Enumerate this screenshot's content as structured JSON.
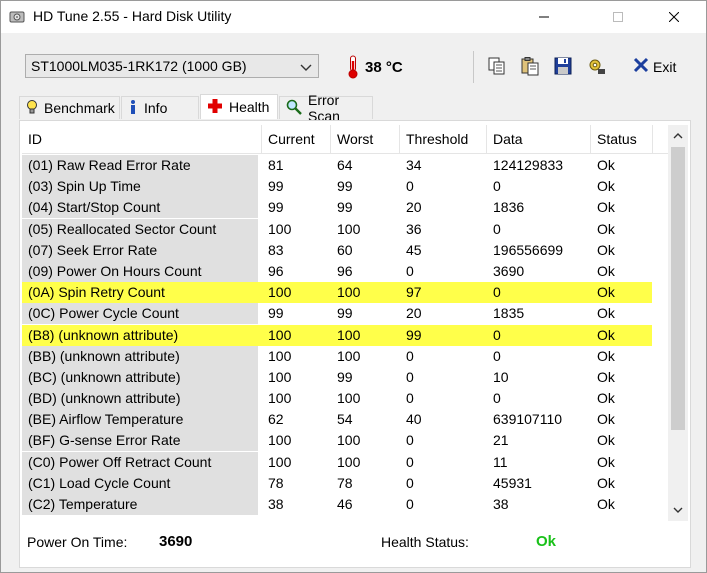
{
  "window": {
    "title": "HD Tune 2.55 - Hard Disk Utility"
  },
  "toolbar": {
    "drive": "ST1000LM035-1RK172 (1000 GB)",
    "temperature": "38 °C",
    "exit_label": "Exit"
  },
  "tabs": [
    {
      "label": "Benchmark",
      "active": false
    },
    {
      "label": "Info",
      "active": false
    },
    {
      "label": "Health",
      "active": true
    },
    {
      "label": "Error Scan",
      "active": false
    }
  ],
  "table": {
    "columns": [
      "ID",
      "Current",
      "Worst",
      "Threshold",
      "Data",
      "Status"
    ],
    "rows": [
      {
        "id": "(01) Raw Read Error Rate",
        "current": "81",
        "worst": "64",
        "threshold": "34",
        "data": "124129833",
        "status": "Ok",
        "highlight": false
      },
      {
        "id": "(03) Spin Up Time",
        "current": "99",
        "worst": "99",
        "threshold": "0",
        "data": "0",
        "status": "Ok",
        "highlight": false
      },
      {
        "id": "(04) Start/Stop Count",
        "current": "99",
        "worst": "99",
        "threshold": "20",
        "data": "1836",
        "status": "Ok",
        "highlight": false
      },
      {
        "id": "(05) Reallocated Sector Count",
        "current": "100",
        "worst": "100",
        "threshold": "36",
        "data": "0",
        "status": "Ok",
        "highlight": false
      },
      {
        "id": "(07) Seek Error Rate",
        "current": "83",
        "worst": "60",
        "threshold": "45",
        "data": "196556699",
        "status": "Ok",
        "highlight": false
      },
      {
        "id": "(09) Power On Hours Count",
        "current": "96",
        "worst": "96",
        "threshold": "0",
        "data": "3690",
        "status": "Ok",
        "highlight": false
      },
      {
        "id": "(0A) Spin Retry Count",
        "current": "100",
        "worst": "100",
        "threshold": "97",
        "data": "0",
        "status": "Ok",
        "highlight": true
      },
      {
        "id": "(0C) Power Cycle Count",
        "current": "99",
        "worst": "99",
        "threshold": "20",
        "data": "1835",
        "status": "Ok",
        "highlight": false
      },
      {
        "id": "(B8) (unknown attribute)",
        "current": "100",
        "worst": "100",
        "threshold": "99",
        "data": "0",
        "status": "Ok",
        "highlight": true
      },
      {
        "id": "(BB) (unknown attribute)",
        "current": "100",
        "worst": "100",
        "threshold": "0",
        "data": "0",
        "status": "Ok",
        "highlight": false
      },
      {
        "id": "(BC) (unknown attribute)",
        "current": "100",
        "worst": "99",
        "threshold": "0",
        "data": "10",
        "status": "Ok",
        "highlight": false
      },
      {
        "id": "(BD) (unknown attribute)",
        "current": "100",
        "worst": "100",
        "threshold": "0",
        "data": "0",
        "status": "Ok",
        "highlight": false
      },
      {
        "id": "(BE) Airflow Temperature",
        "current": "62",
        "worst": "54",
        "threshold": "40",
        "data": "639107110",
        "status": "Ok",
        "highlight": false
      },
      {
        "id": "(BF) G-sense Error Rate",
        "current": "100",
        "worst": "100",
        "threshold": "0",
        "data": "21",
        "status": "Ok",
        "highlight": false
      },
      {
        "id": "(C0) Power Off Retract Count",
        "current": "100",
        "worst": "100",
        "threshold": "0",
        "data": "11",
        "status": "Ok",
        "highlight": false
      },
      {
        "id": "(C1) Load Cycle Count",
        "current": "78",
        "worst": "78",
        "threshold": "0",
        "data": "45931",
        "status": "Ok",
        "highlight": false
      },
      {
        "id": "(C2) Temperature",
        "current": "38",
        "worst": "46",
        "threshold": "0",
        "data": "38",
        "status": "Ok",
        "highlight": false
      }
    ]
  },
  "footer": {
    "power_on_label": "Power On Time:",
    "power_on_value": "3690",
    "health_label": "Health Status:",
    "health_value": "Ok"
  },
  "colors": {
    "highlight": "#ffff4a",
    "ok_green": "#19c119"
  }
}
